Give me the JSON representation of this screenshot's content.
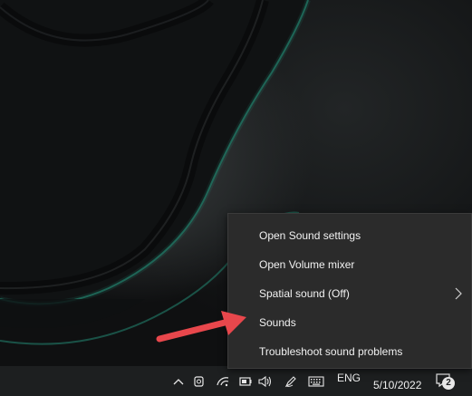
{
  "context_menu": {
    "items": [
      {
        "label": "Open Sound settings",
        "has_submenu": false
      },
      {
        "label": "Open Volume mixer",
        "has_submenu": false
      },
      {
        "label": "Spatial sound (Off)",
        "has_submenu": true
      },
      {
        "label": "Sounds",
        "has_submenu": false
      },
      {
        "label": "Troubleshoot sound problems",
        "has_submenu": false
      }
    ]
  },
  "taskbar": {
    "language": "ENG",
    "date": "5/10/2022",
    "notification_count": "2"
  },
  "colors": {
    "menu_background": "#2b2b2b",
    "taskbar_background": "#1d1f20",
    "annotation_arrow": "#e8474c",
    "desktop_teal_glow": "#1f6f5e"
  },
  "icons": [
    "chevron-up-icon",
    "meet-now-icon",
    "wifi-icon",
    "battery-icon",
    "speaker-icon",
    "pen-icon",
    "keyboard-icon",
    "notification-icon",
    "submenu-chevron-icon"
  ]
}
